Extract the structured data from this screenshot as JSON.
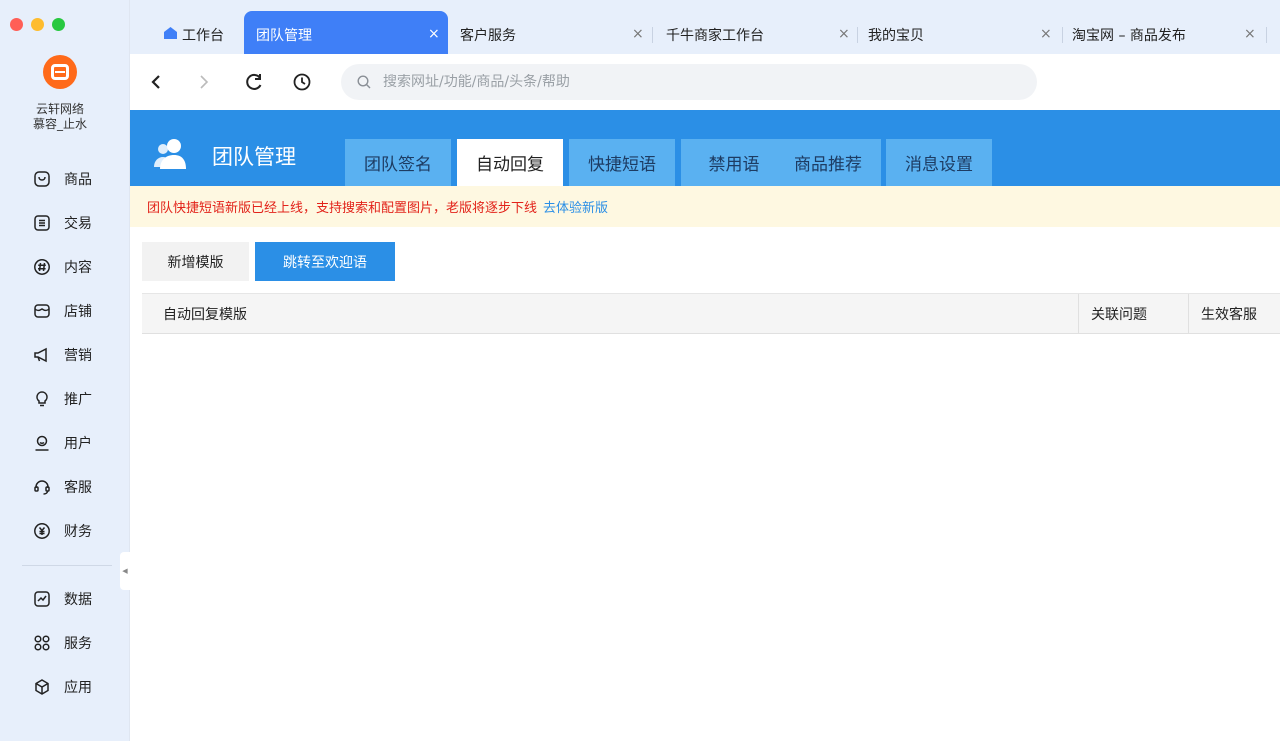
{
  "sidebar": {
    "shop_name_line1": "云轩网络",
    "shop_name_line2": "慕容_止水",
    "items_top": [
      {
        "label": "商品",
        "icon": "product-icon"
      },
      {
        "label": "交易",
        "icon": "trade-icon"
      },
      {
        "label": "内容",
        "icon": "content-icon"
      },
      {
        "label": "店铺",
        "icon": "store-icon"
      },
      {
        "label": "营销",
        "icon": "marketing-icon"
      },
      {
        "label": "推广",
        "icon": "promotion-icon"
      },
      {
        "label": "用户",
        "icon": "user-icon"
      },
      {
        "label": "客服",
        "icon": "customer-service-icon"
      },
      {
        "label": "财务",
        "icon": "finance-icon"
      }
    ],
    "items_bottom": [
      {
        "label": "数据",
        "icon": "data-icon"
      },
      {
        "label": "服务",
        "icon": "service-icon"
      },
      {
        "label": "应用",
        "icon": "apps-icon"
      }
    ]
  },
  "tabs": [
    {
      "label": "工作台",
      "active": false,
      "closable": false
    },
    {
      "label": "团队管理",
      "active": true,
      "closable": true
    },
    {
      "label": "客户服务",
      "active": false,
      "closable": true
    },
    {
      "label": "千牛商家工作台",
      "active": false,
      "closable": true
    },
    {
      "label": "我的宝贝",
      "active": false,
      "closable": true
    },
    {
      "label": "淘宝网 – 商品发布",
      "active": false,
      "closable": true
    }
  ],
  "tab_close_glyph": "×",
  "address": {
    "placeholder": "搜索网址/功能/商品/头条/帮助",
    "value": ""
  },
  "header": {
    "title": "团队管理",
    "subtabs": [
      {
        "label": "团队签名",
        "active": false
      },
      {
        "label": "自动回复",
        "active": true
      },
      {
        "label": "快捷短语",
        "active": false
      },
      {
        "label": "禁用语",
        "active": false
      },
      {
        "label": "商品推荐",
        "active": false
      },
      {
        "label": "消息设置",
        "active": false
      }
    ]
  },
  "notice": {
    "text": "团队快捷短语新版已经上线，支持搜索和配置图片，老版将逐步下线",
    "link": "去体验新版"
  },
  "actions": {
    "new_template": "新增模版",
    "jump_welcome": "跳转至欢迎语"
  },
  "table": {
    "columns": [
      "自动回复模版",
      "关联问题",
      "生效客服"
    ],
    "rows": []
  },
  "colors": {
    "brand_blue": "#2b8fe6",
    "active_tab_blue": "#3f7ff7",
    "notice_red": "#e2231a",
    "logo_orange": "#ff6a1a"
  }
}
